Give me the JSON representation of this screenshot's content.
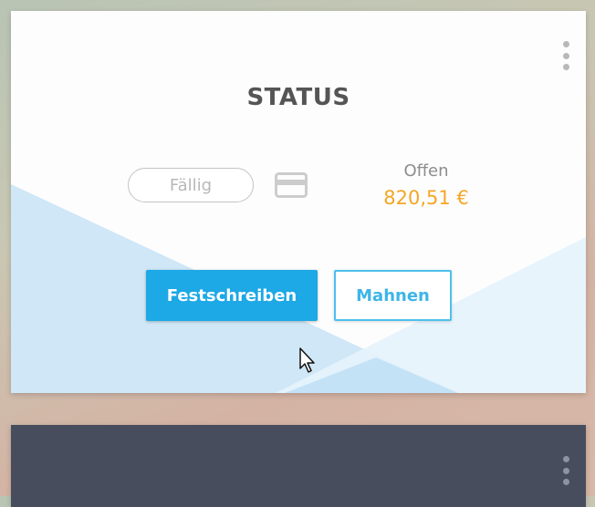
{
  "status_card": {
    "title": "STATUS",
    "due_badge": "Fällig",
    "open_label": "Offen",
    "open_amount": "820,51 €",
    "primary_button": "Festschreiben",
    "secondary_button": "Mahnen",
    "icons": {
      "menu": "more-vertical-icon",
      "payment": "credit-card-icon"
    },
    "colors": {
      "primary": "#1da8e6",
      "amount": "#f5a623",
      "secondary_border": "#4cc0ec"
    }
  },
  "next_card": {
    "icons": {
      "menu": "more-vertical-icon"
    },
    "colors": {
      "background": "#484d5e"
    }
  }
}
